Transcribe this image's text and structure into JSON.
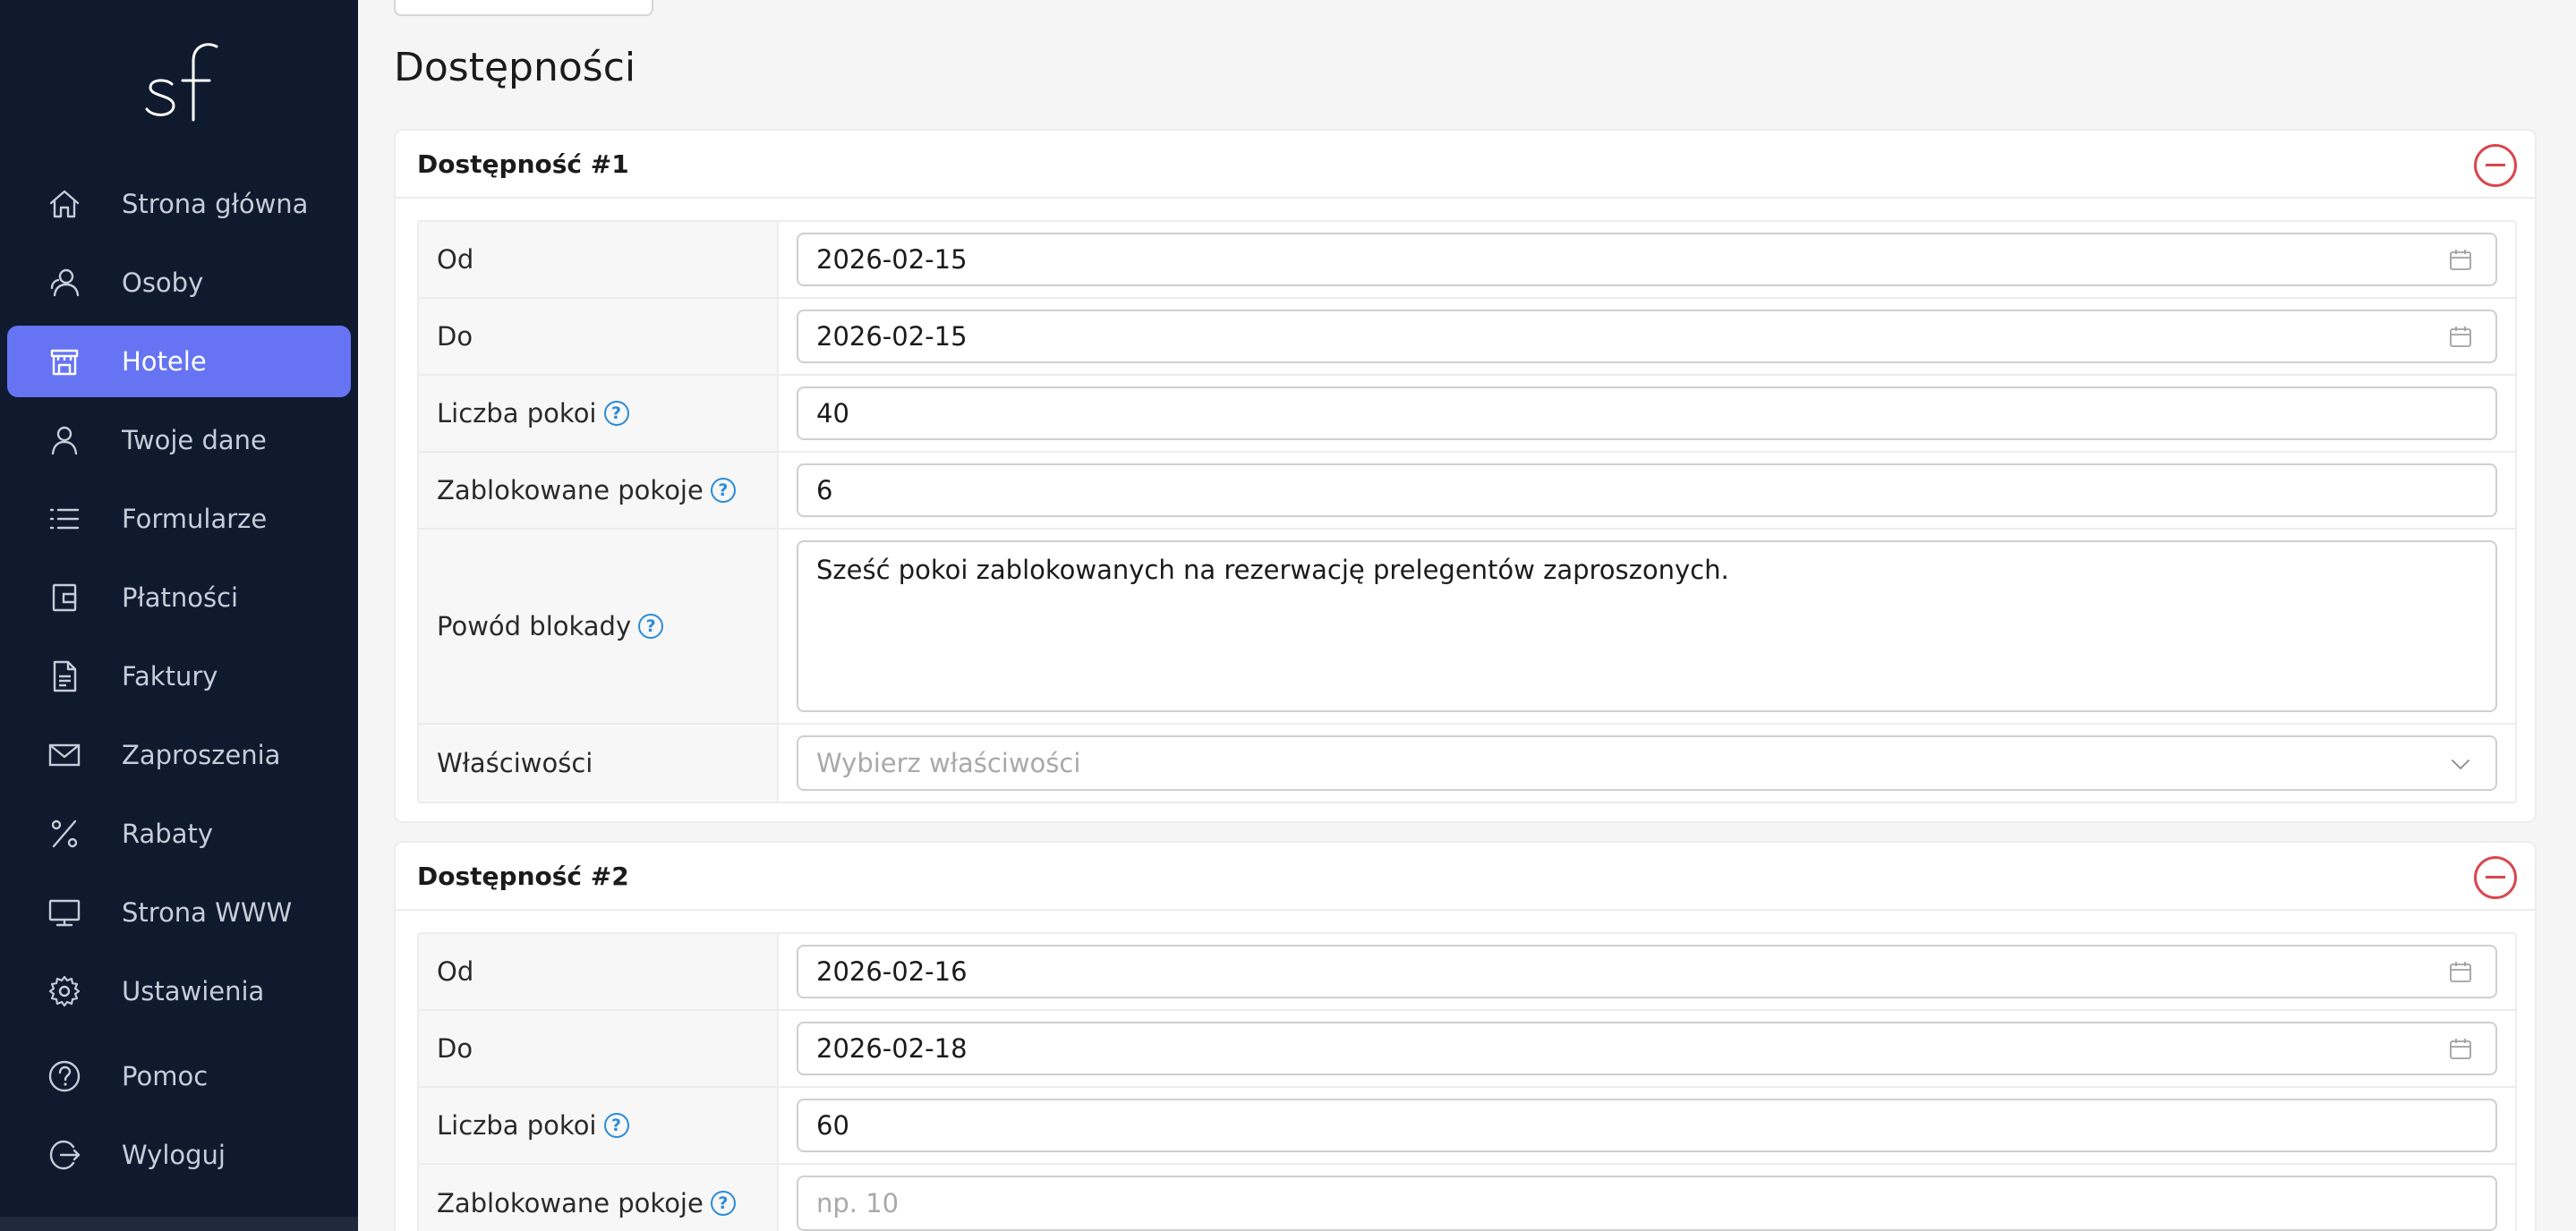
{
  "logo": {
    "text": "sf"
  },
  "sidebar": {
    "items": [
      {
        "label": "Strona główna",
        "icon": "home-icon",
        "active": false
      },
      {
        "label": "Osoby",
        "icon": "users-icon",
        "active": false
      },
      {
        "label": "Hotele",
        "icon": "hotel-icon",
        "active": true
      },
      {
        "label": "Twoje dane",
        "icon": "user-icon",
        "active": false
      },
      {
        "label": "Formularze",
        "icon": "list-icon",
        "active": false
      },
      {
        "label": "Płatności",
        "icon": "wallet-icon",
        "active": false
      },
      {
        "label": "Faktury",
        "icon": "document-icon",
        "active": false
      },
      {
        "label": "Zaproszenia",
        "icon": "envelope-icon",
        "active": false
      },
      {
        "label": "Rabaty",
        "icon": "percent-icon",
        "active": false
      },
      {
        "label": "Strona WWW",
        "icon": "monitor-icon",
        "active": false
      },
      {
        "label": "Ustawienia",
        "icon": "gear-icon",
        "active": false
      },
      {
        "label": "Pomoc",
        "icon": "help-circle-icon",
        "active": false
      },
      {
        "label": "Wyloguj",
        "icon": "logout-icon",
        "active": false
      }
    ]
  },
  "page": {
    "title": "Dostępności"
  },
  "availabilities": [
    {
      "title": "Dostępność #1",
      "fields": {
        "from_label": "Od",
        "from_value": "2026-02-15",
        "to_label": "Do",
        "to_value": "2026-02-15",
        "rooms_label": "Liczba pokoi",
        "rooms_value": "40",
        "blocked_label": "Zablokowane pokoje",
        "blocked_value": "6",
        "reason_label": "Powód blokady",
        "reason_value": "Sześć pokoi zablokowanych na rezerwację prelegentów zaproszonych.",
        "props_label": "Właściwości",
        "props_placeholder": "Wybierz właściwości"
      }
    },
    {
      "title": "Dostępność #2",
      "fields": {
        "from_label": "Od",
        "from_value": "2026-02-16",
        "to_label": "Do",
        "to_value": "2026-02-18",
        "rooms_label": "Liczba pokoi",
        "rooms_value": "60",
        "blocked_label": "Zablokowane pokoje",
        "blocked_placeholder": "np. 10"
      }
    }
  ],
  "colors": {
    "sidebar_bg": "#0f1a2e",
    "active_item": "#6674f4",
    "help_icon": "#2a8bd8",
    "remove_icon": "#d9474e"
  }
}
